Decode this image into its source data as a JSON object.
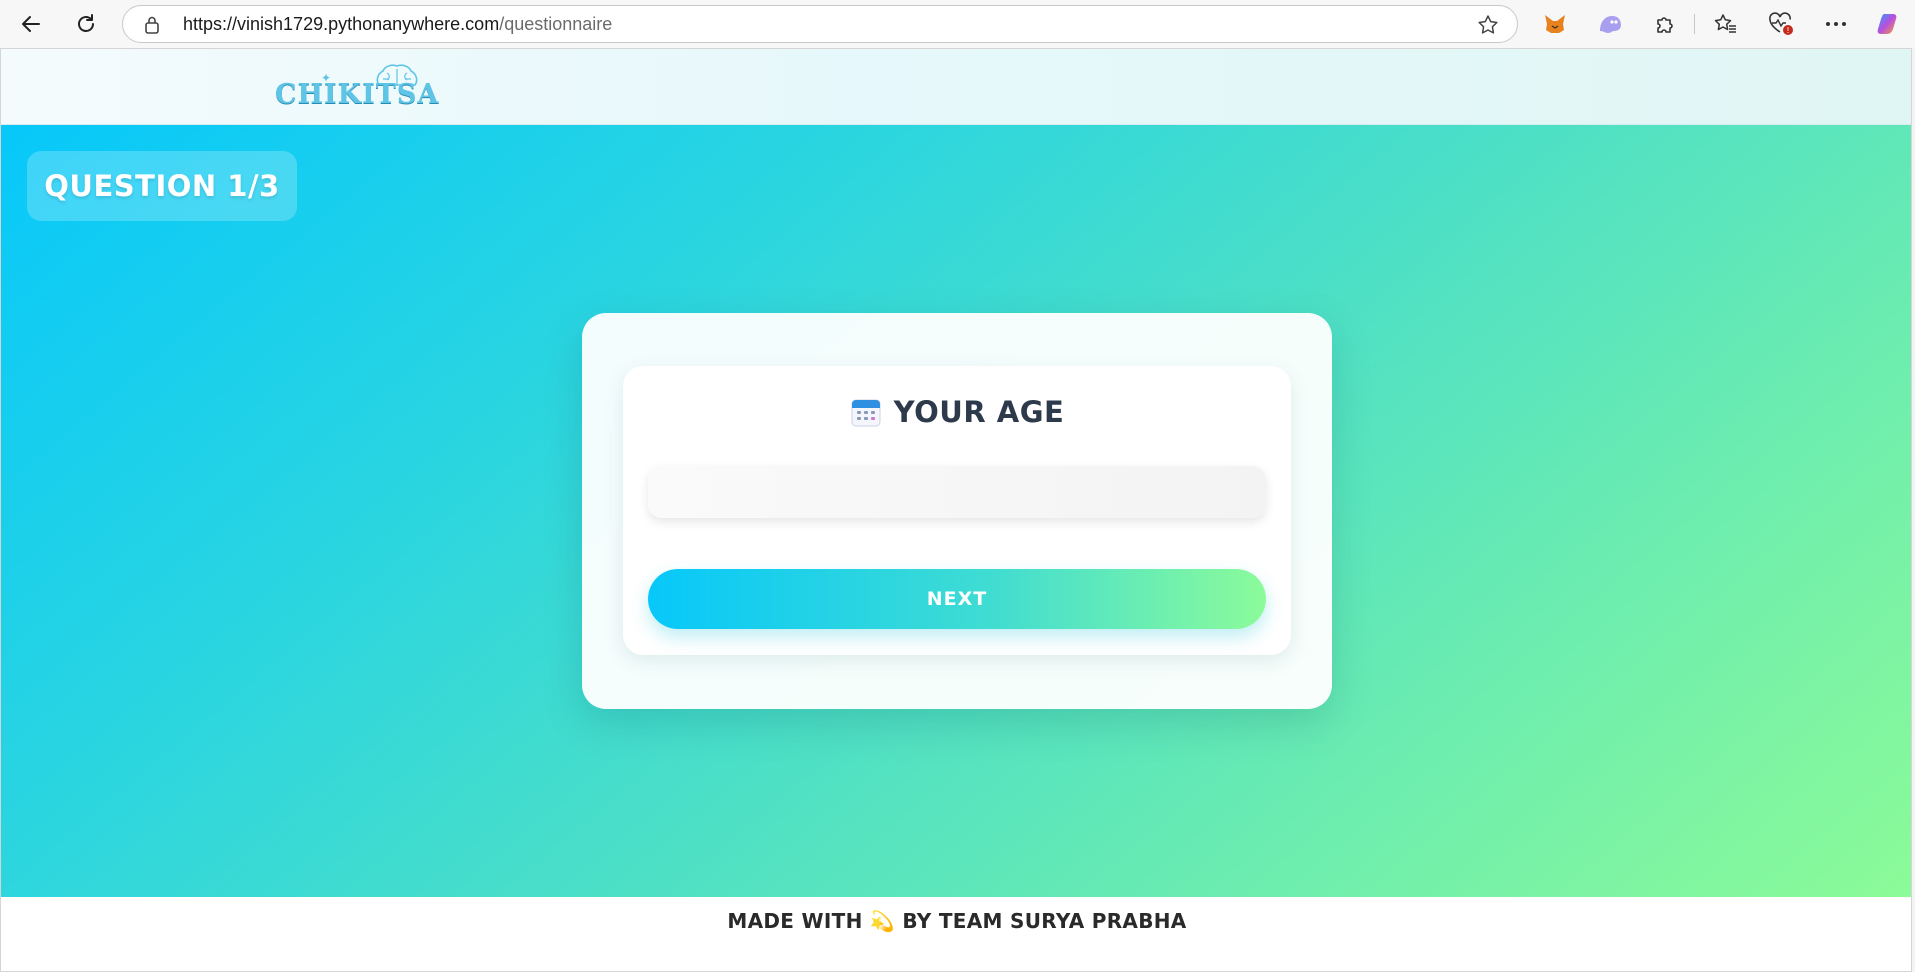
{
  "browser": {
    "url_host": "https://vinish1729.pythonanywhere.com",
    "url_path": "/questionnaire"
  },
  "icons": {
    "back": "arrow-left-icon",
    "refresh": "refresh-icon",
    "lock": "lock-icon",
    "star": "star-icon",
    "metamask": "fox-extension-icon",
    "ghost": "ghost-extension-icon",
    "extensions": "puzzle-icon",
    "favorites": "favorites-icon",
    "health": "heart-monitor-icon",
    "more": "more-dots-icon",
    "copilot": "copilot-icon",
    "calendar": "calendar-icon"
  },
  "site": {
    "logo_text": "CHIKITSA"
  },
  "question": {
    "badge": "QUESTION 1/3",
    "title": "YOUR AGE",
    "input_value": "",
    "input_placeholder": "",
    "next_label": "NEXT"
  },
  "footer": {
    "text_before": "MADE WITH",
    "emoji": "💫",
    "text_after": "BY TEAM SURYA PRABHA"
  },
  "colors": {
    "gradient_start": "#07c8fa",
    "gradient_end": "#8cfb98",
    "title_color": "#2d3a4b"
  }
}
